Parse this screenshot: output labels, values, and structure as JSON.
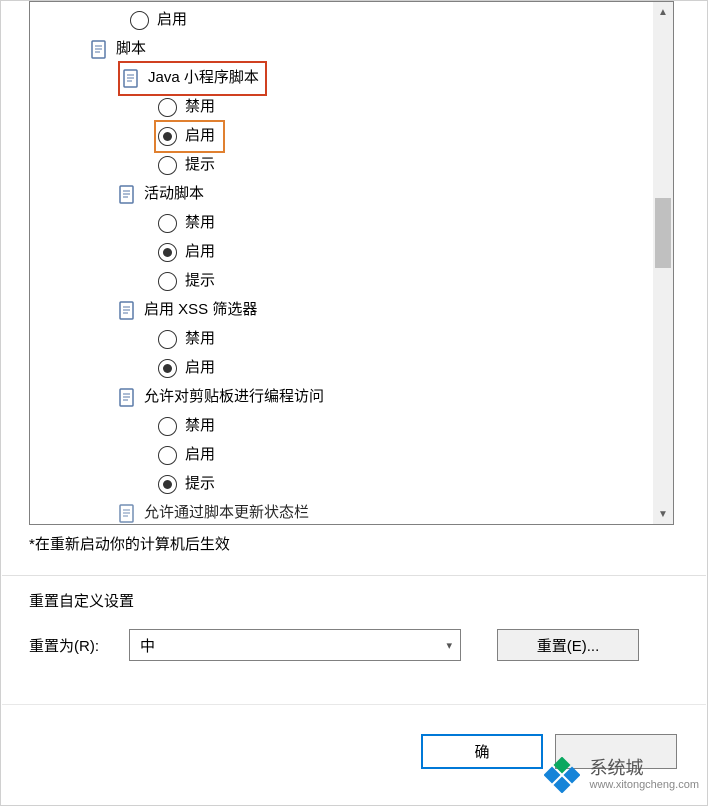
{
  "tree": {
    "partial_top_option": "启用",
    "script_section": "脚本",
    "java_applet": {
      "label": "Java 小程序脚本",
      "options": [
        "禁用",
        "启用",
        "提示"
      ],
      "selected": 1
    },
    "active_script": {
      "label": "活动脚本",
      "options": [
        "禁用",
        "启用",
        "提示"
      ],
      "selected": 1
    },
    "xss_filter": {
      "label": "启用 XSS 筛选器",
      "options": [
        "禁用",
        "启用"
      ],
      "selected": 1
    },
    "clipboard": {
      "label": "允许对剪贴板进行编程访问",
      "options": [
        "禁用",
        "启用",
        "提示"
      ],
      "selected": 2
    },
    "partial_bottom": "允许通过脚本更新状态栏"
  },
  "restart_note": "*在重新启动你的计算机后生效",
  "reset": {
    "group_title": "重置自定义设置",
    "label": "重置为(R):",
    "selected": "中",
    "button": "重置(E)..."
  },
  "buttons": {
    "ok": "确",
    "cancel": ""
  },
  "watermark": {
    "cn": "系统城",
    "en": "www.xitongcheng.com"
  }
}
